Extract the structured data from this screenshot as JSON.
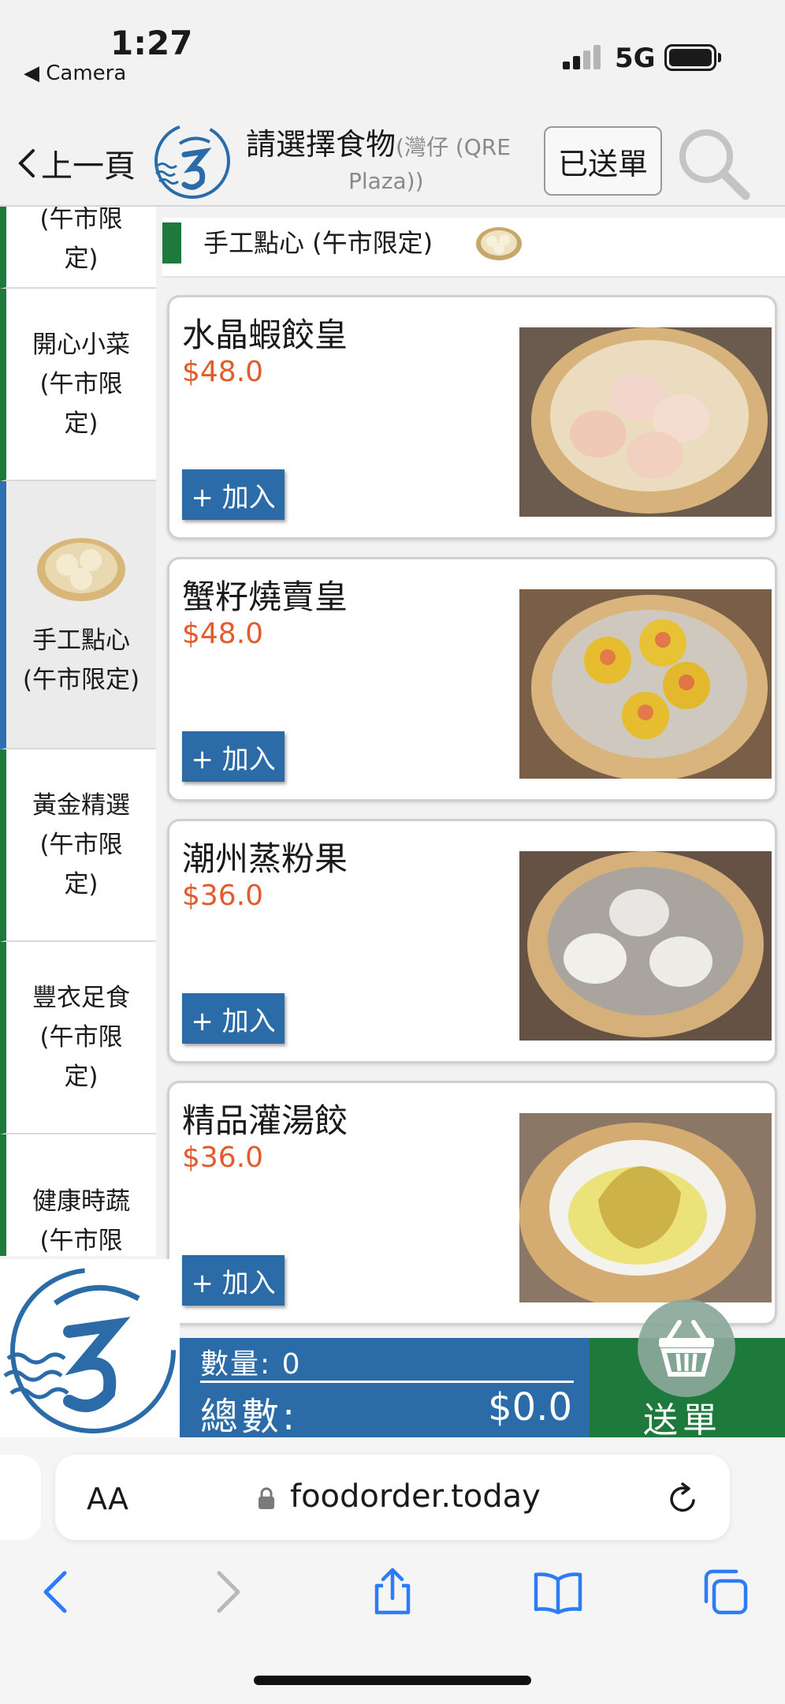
{
  "status": {
    "time": "1:27",
    "back_app": "◀ Camera",
    "network": "5G"
  },
  "header": {
    "back_label": "上一頁",
    "title": "請選擇食物",
    "subtitle_part1": "(灣仔 (QRE",
    "subtitle_part2": "Plaza))",
    "sent_label": "已送單"
  },
  "sidebar": {
    "items": [
      {
        "label": "(午市限\n定)"
      },
      {
        "label": "開心小菜\n(午市限\n定)"
      },
      {
        "label": "手工點心\n(午市限定)"
      },
      {
        "label": "黃金精選\n(午市限\n定)"
      },
      {
        "label": "豐衣足食\n(午市限\n定)"
      },
      {
        "label": "健康時蔬\n(午市限"
      }
    ]
  },
  "section": {
    "title": "手工點心 (午市限定)"
  },
  "menu": {
    "add_label": "+ 加入",
    "items": [
      {
        "name": "水晶蝦餃皇",
        "price": "$48.0"
      },
      {
        "name": "蟹籽燒賣皇",
        "price": "$48.0"
      },
      {
        "name": "潮州蒸粉果",
        "price": "$36.0"
      },
      {
        "name": "精品灌湯餃",
        "price": "$36.0"
      }
    ]
  },
  "cart": {
    "qty_text": "數量: 0",
    "total_label": "總數:",
    "total_value": "$0.0",
    "submit_label": "送單"
  },
  "browser": {
    "aa": "AA",
    "url": "foodorder.today"
  },
  "colors": {
    "green": "#1e7a3c",
    "blue": "#2b6ca8",
    "price": "#e35a2b"
  }
}
